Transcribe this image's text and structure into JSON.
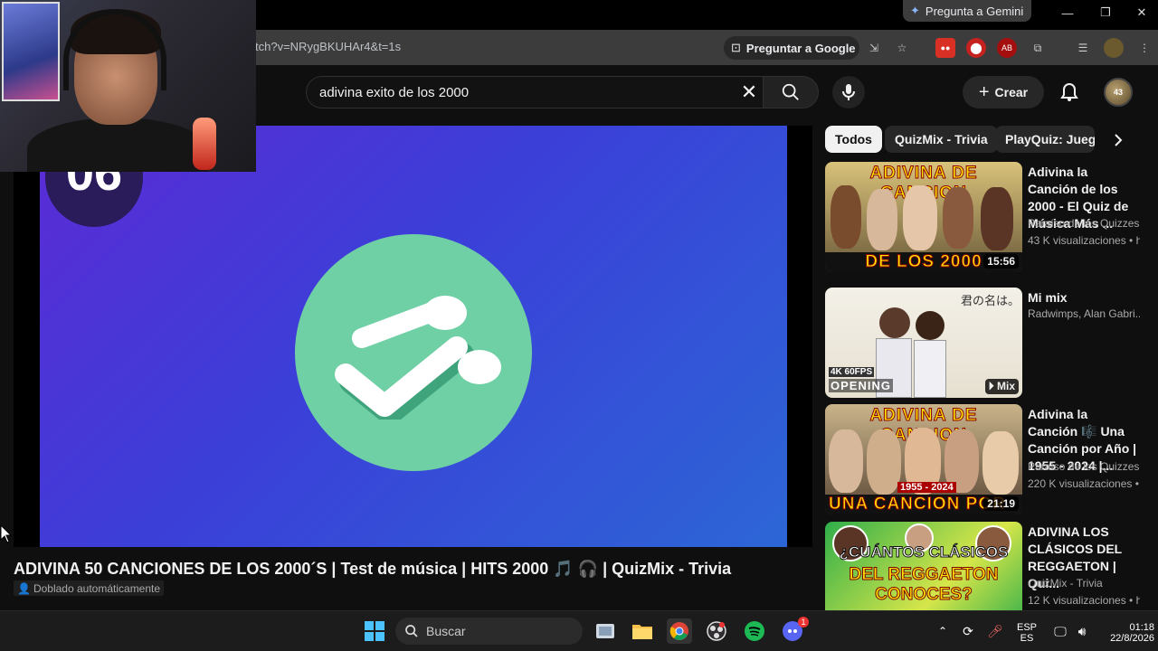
{
  "browser": {
    "gemini_label": "Pregunta a Gemini",
    "url": "tch?v=NRygBKUHAr4&t=1s",
    "ask_google_label": "Preguntar a Google"
  },
  "youtube": {
    "search_query": "adivina exito de los 2000",
    "create_label": "Crear",
    "avatar_text": "43"
  },
  "video": {
    "overlay_number": "06",
    "title": "ADIVINA 50 CANCIONES DE LOS 2000´S | Test de música | HITS 2000 🎵 🎧 | QuizMix - Trivia",
    "dub_badge": "Doblado automáticamente"
  },
  "chips": [
    "Todos",
    "QuizMix - Trivia",
    "PlayQuiz: Juego"
  ],
  "recommendations": [
    {
      "title": "Adivina la Canción de los 2000 - El Quiz de Música Más ...",
      "channel": "Paraíso de los Quizzes",
      "meta": "43 K visualizaciones • h.",
      "duration": "15:56",
      "banner_top": "ADIVINA DE CANCION",
      "banner_bottom": "DE LOS 2000"
    },
    {
      "title": "Mi mix",
      "channel": "Radwimps, Alan Gabri...",
      "meta": "",
      "duration": "Mix",
      "banner_top": "君の名は。",
      "banner_bottom": "OPENING",
      "badge": "4K 60FPS"
    },
    {
      "title": "Adivina la Canción 🎼 Una Canción por Año | 1955 - 2024 |...",
      "channel": "Paraíso de los Quizzes",
      "meta": "220 K visualizaciones • I",
      "duration": "21:19",
      "banner_top": "ADIVINA DE CANCION",
      "banner_bottom": "UNA CANCION POR",
      "year_range": "1955 - 2024"
    },
    {
      "title": "ADIVINA LOS CLÁSICOS DEL REGGAETON | Qui...",
      "channel": "QuizMix - Trivia",
      "meta": "12 K visualizaciones • h.",
      "duration": "",
      "banner_top": "¿CUÁNTOS CLÁSICOS",
      "banner_bottom": "DEL REGGAETON CONOCES?"
    }
  ],
  "taskbar": {
    "search_label": "Buscar",
    "lang_top": "ESP",
    "lang_bottom": "ES",
    "time": "01:18",
    "date": "22/8/2026",
    "discord_badge": "1"
  },
  "colors": {
    "youtube_bg": "#0f0f0f",
    "video_gradient_start": "#5b2bd6",
    "video_gradient_end": "#2c66d6",
    "music_disc": "#6fcfa5",
    "banner_yellow": "#ffe400"
  }
}
